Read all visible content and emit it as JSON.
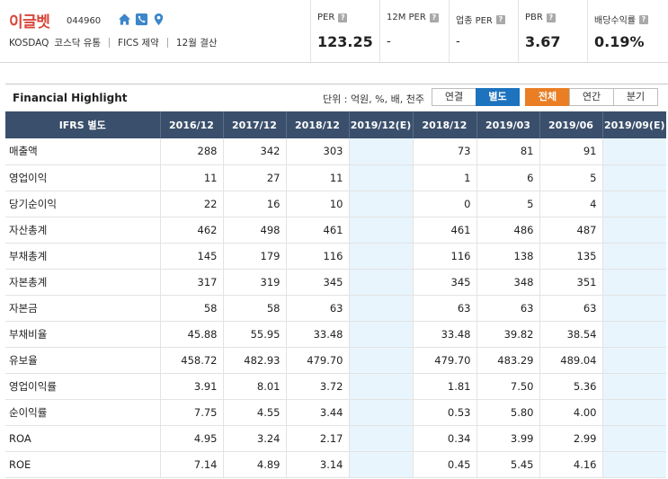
{
  "company": {
    "name": "이글벳",
    "code": "044960",
    "market": "KOSDAQ",
    "sector": "코스닥 유통",
    "fics": "FICS 제약",
    "settlement": "12월 결산"
  },
  "icons": [
    "home-icon",
    "phone-icon",
    "location-pin-icon"
  ],
  "metrics": [
    {
      "label": "PER",
      "value": "123.25"
    },
    {
      "label": "12M PER",
      "value": "-"
    },
    {
      "label": "업종 PER",
      "value": "-"
    },
    {
      "label": "PBR",
      "value": "3.67"
    },
    {
      "label": "배당수익률",
      "value": "0.19%"
    }
  ],
  "section": {
    "title": "Financial Highlight",
    "unit": "단위 : 억원, %, 배, 천주",
    "buttons": {
      "consolidated": "연결",
      "separate": "별도",
      "all": "전체",
      "annual": "연간",
      "quarterly": "분기"
    }
  },
  "colors": {
    "name_red": "#d9463a",
    "header_navy": "#3a4f6b",
    "active_blue": "#1e73be",
    "active_orange": "#ea7e25",
    "estimate_bg": "#e9f5fd"
  },
  "table": {
    "header_label": "IFRS 별도",
    "columns": [
      "2016/12",
      "2017/12",
      "2018/12",
      "2019/12(E)",
      "2018/12",
      "2019/03",
      "2019/06",
      "2019/09(E)"
    ],
    "rows": [
      {
        "label": "매출액",
        "values": [
          "288",
          "342",
          "303",
          "",
          "73",
          "81",
          "91",
          ""
        ]
      },
      {
        "label": "영업이익",
        "values": [
          "11",
          "27",
          "11",
          "",
          "1",
          "6",
          "5",
          ""
        ]
      },
      {
        "label": "당기순이익",
        "values": [
          "22",
          "16",
          "10",
          "",
          "0",
          "5",
          "4",
          ""
        ]
      },
      {
        "label": "자산총계",
        "values": [
          "462",
          "498",
          "461",
          "",
          "461",
          "486",
          "487",
          ""
        ]
      },
      {
        "label": "부채총계",
        "values": [
          "145",
          "179",
          "116",
          "",
          "116",
          "138",
          "135",
          ""
        ]
      },
      {
        "label": "자본총계",
        "values": [
          "317",
          "319",
          "345",
          "",
          "345",
          "348",
          "351",
          ""
        ]
      },
      {
        "label": "자본금",
        "values": [
          "58",
          "58",
          "63",
          "",
          "63",
          "63",
          "63",
          ""
        ]
      },
      {
        "label": "부채비율",
        "values": [
          "45.88",
          "55.95",
          "33.48",
          "",
          "33.48",
          "39.82",
          "38.54",
          ""
        ]
      },
      {
        "label": "유보율",
        "values": [
          "458.72",
          "482.93",
          "479.70",
          "",
          "479.70",
          "483.29",
          "489.04",
          ""
        ]
      },
      {
        "label": "영업이익률",
        "values": [
          "3.91",
          "8.01",
          "3.72",
          "",
          "1.81",
          "7.50",
          "5.36",
          ""
        ]
      },
      {
        "label": "순이익률",
        "values": [
          "7.75",
          "4.55",
          "3.44",
          "",
          "0.53",
          "5.80",
          "4.00",
          ""
        ]
      },
      {
        "label": "ROA",
        "values": [
          "4.95",
          "3.24",
          "2.17",
          "",
          "0.34",
          "3.99",
          "2.99",
          ""
        ]
      },
      {
        "label": "ROE",
        "values": [
          "7.14",
          "4.89",
          "3.14",
          "",
          "0.45",
          "5.45",
          "4.16",
          ""
        ]
      }
    ]
  }
}
